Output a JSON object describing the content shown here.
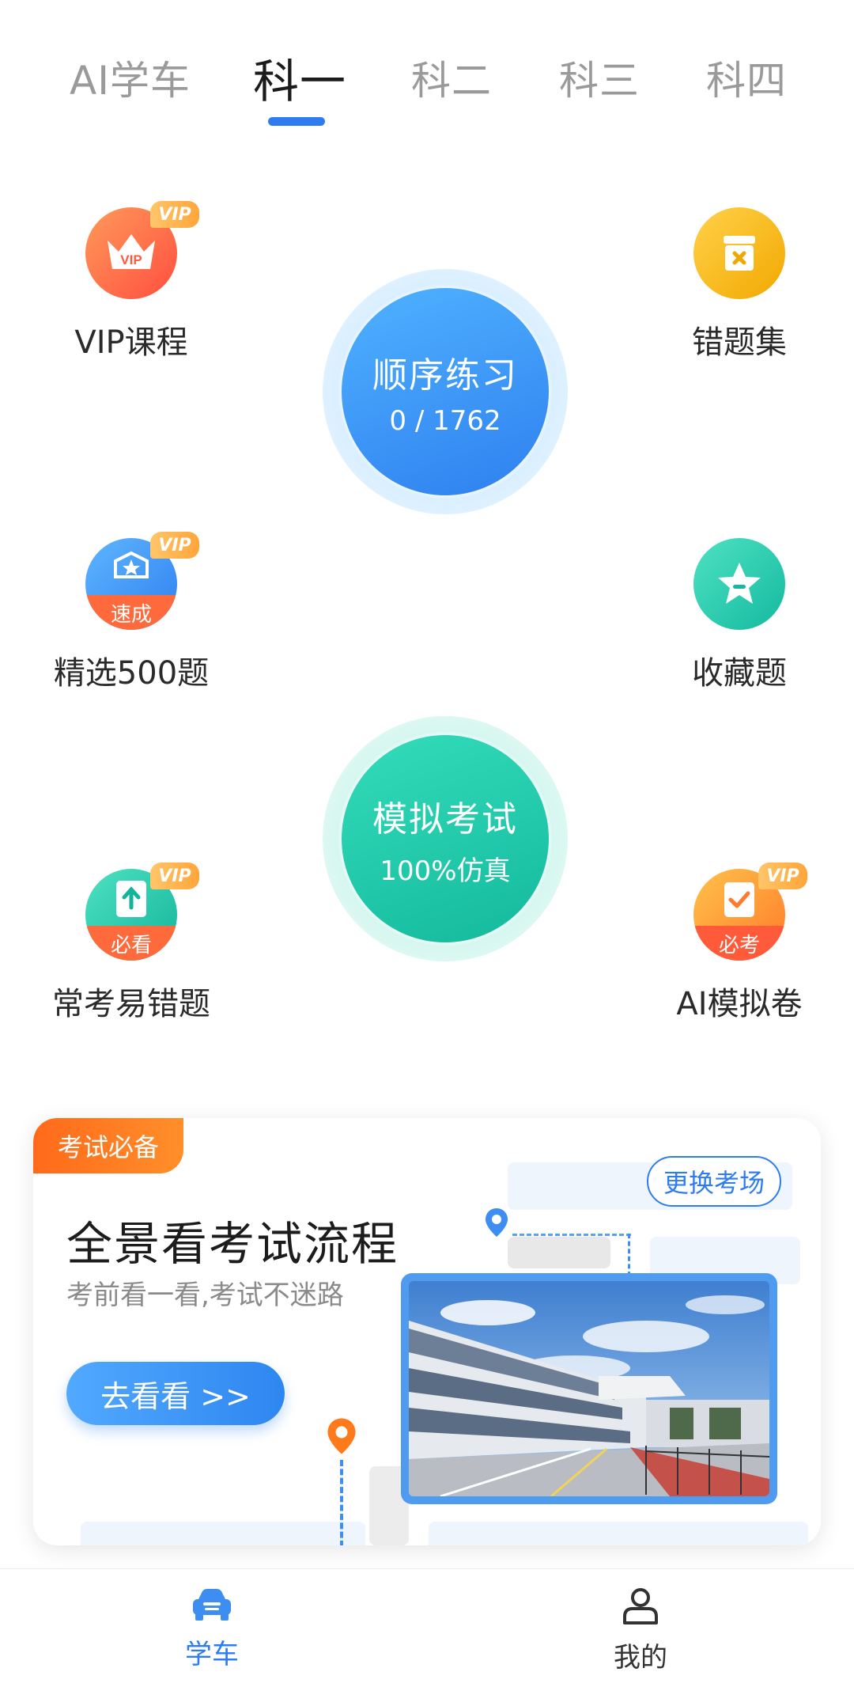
{
  "tabs": [
    "AI学车",
    "科一",
    "科二",
    "科三",
    "科四"
  ],
  "active_tab": "科一",
  "features": {
    "vip_course": {
      "label": "VIP课程",
      "badge": "VIP",
      "icon_text": "VIP"
    },
    "wrong_set": {
      "label": "错题集"
    },
    "selected500": {
      "label": "精选500题",
      "badge": "VIP",
      "band": "速成"
    },
    "favorites": {
      "label": "收藏题"
    },
    "frequent_wrong": {
      "label": "常考易错题",
      "badge": "VIP",
      "band": "必看"
    },
    "ai_mock": {
      "label": "AI模拟卷",
      "badge": "VIP",
      "band": "必考"
    }
  },
  "sequential": {
    "title": "顺序练习",
    "progress": "0 / 1762"
  },
  "mock_exam": {
    "title": "模拟考试",
    "subtitle": "100%仿真"
  },
  "card": {
    "tag": "考试必备",
    "title": "全景看考试流程",
    "subtitle": "考前看一看,考试不迷路",
    "button": "去看看 >>",
    "change_button": "更换考场"
  },
  "bottom_nav": [
    {
      "label": "学车",
      "icon": "car-icon",
      "active": true
    },
    {
      "label": "我的",
      "icon": "person-icon",
      "active": false
    }
  ],
  "colors": {
    "accent": "#2f7cf0",
    "blue_circle": "#3b8ff3",
    "green_circle": "#1fc6a4",
    "orange": "#ff6a1a",
    "vip_gold": "#ffb347"
  }
}
